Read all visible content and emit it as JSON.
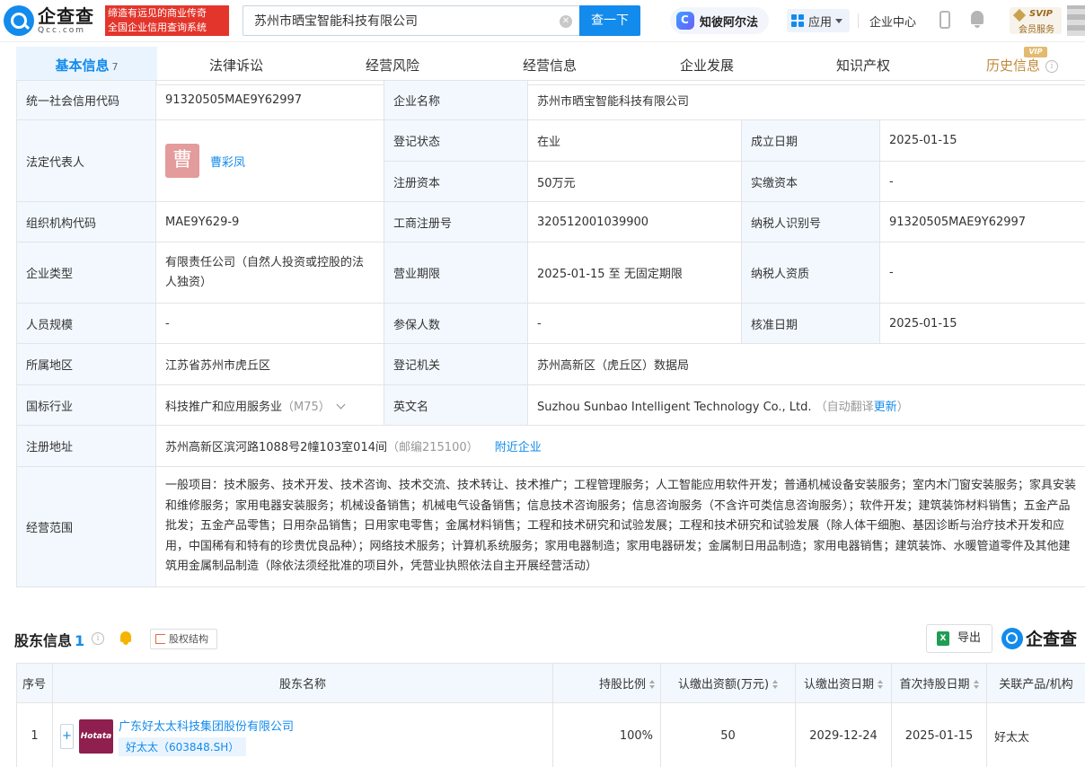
{
  "header": {
    "logo_cn": "企查查",
    "logo_en": "Qcc.com",
    "slogan_line1": "缔造有远见的商业传奇",
    "slogan_line2": "全国企业信用查询系统",
    "search_value": "苏州市晒宝智能科技有限公司",
    "search_button": "查一下",
    "ai_label": "知彼阿尔法",
    "app_label": "应用",
    "enterprise_center": "企业中心",
    "svip_label": "SVIP",
    "svip_sub": "会员服务"
  },
  "tabs": [
    {
      "label": "基本信息",
      "count": "7"
    },
    {
      "label": "法律诉讼"
    },
    {
      "label": "经营风险"
    },
    {
      "label": "经营信息"
    },
    {
      "label": "企业发展"
    },
    {
      "label": "知识产权"
    },
    {
      "label": "历史信息",
      "badge": "VIP"
    }
  ],
  "info": {
    "credit_code_label": "统一社会信用代码",
    "credit_code": "91320505MAE9Y62997",
    "company_name_label": "企业名称",
    "company_name": "苏州市晒宝智能科技有限公司",
    "legal_rep_label": "法定代表人",
    "legal_rep_avatar": "曹",
    "legal_rep": "曹彩凤",
    "reg_status_label": "登记状态",
    "reg_status": "在业",
    "founded_label": "成立日期",
    "founded": "2025-01-15",
    "reg_capital_label": "注册资本",
    "reg_capital": "50万元",
    "paid_capital_label": "实缴资本",
    "paid_capital": "-",
    "org_code_label": "组织机构代码",
    "org_code": "MAE9Y629-9",
    "biz_reg_no_label": "工商注册号",
    "biz_reg_no": "320512001039900",
    "taxpayer_id_label": "纳税人识别号",
    "taxpayer_id": "91320505MAE9Y62997",
    "ent_type_label": "企业类型",
    "ent_type": "有限责任公司（自然人投资或控股的法人独资）",
    "biz_term_label": "营业期限",
    "biz_term": "2025-01-15 至 无固定期限",
    "taxpayer_qual_label": "纳税人资质",
    "taxpayer_qual": "-",
    "staff_label": "人员规模",
    "staff": "-",
    "insured_label": "参保人数",
    "insured": "-",
    "approved_label": "核准日期",
    "approved": "2025-01-15",
    "region_label": "所属地区",
    "region": "江苏省苏州市虎丘区",
    "authority_label": "登记机关",
    "authority": "苏州高新区（虎丘区）数据局",
    "industry_label": "国标行业",
    "industry": "科技推广和应用服务业",
    "industry_code": "（M75）",
    "en_name_label": "英文名",
    "en_name": "Suzhou Sunbao Intelligent Technology Co., Ltd.",
    "auto_translate": "（自动翻译",
    "update": "更新",
    "auto_translate_end": "）",
    "address_label": "注册地址",
    "address": "苏州高新区滨河路1088号2幢103室014间",
    "postcode": "（邮编215100）",
    "nearby": "附近企业",
    "scope_label": "经营范围",
    "scope": "一般项目：技术服务、技术开发、技术咨询、技术交流、技术转让、技术推广；工程管理服务；人工智能应用软件开发；普通机械设备安装服务；室内木门窗安装服务；家具安装和维修服务；家用电器安装服务；机械设备销售；机械电气设备销售；信息技术咨询服务；信息咨询服务（不含许可类信息咨询服务）；软件开发；建筑装饰材料销售；五金产品批发；五金产品零售；日用杂品销售；日用家电零售；金属材料销售；工程和技术研究和试验发展；工程和技术研究和试验发展（除人体干细胞、基因诊断与治疗技术开发和应用，中国稀有和特有的珍贵优良品种）；网络技术服务；计算机系统服务；家用电器制造；家用电器研发；金属制日用品制造；家用电器销售；建筑装饰、水暖管道零件及其他建筑用金属制品制造（除依法须经批准的项目外，凭营业执照依法自主开展经营活动）"
  },
  "shareholders": {
    "title": "股东信息",
    "count": "1",
    "equity_label": "股权结构",
    "export_label": "导出",
    "watermark": "企查查",
    "headers": [
      "序号",
      "股东名称",
      "持股比例",
      "认缴出资额(万元)",
      "认缴出资日期",
      "首次持股日期",
      "关联产品/机构"
    ],
    "rows": [
      {
        "no": "1",
        "logo_text": "Hotata",
        "name": "广东好太太科技集团股份有限公司",
        "stock": "好太太（603848.SH）",
        "ratio": "100%",
        "amount": "50",
        "sub_date": "2029-12-24",
        "first_date": "2025-01-15",
        "related": "好太太"
      }
    ]
  },
  "colors": {
    "accent": "#128bed",
    "label_bg": "#f2f8fe",
    "slogan_bg": "#e3352b"
  }
}
